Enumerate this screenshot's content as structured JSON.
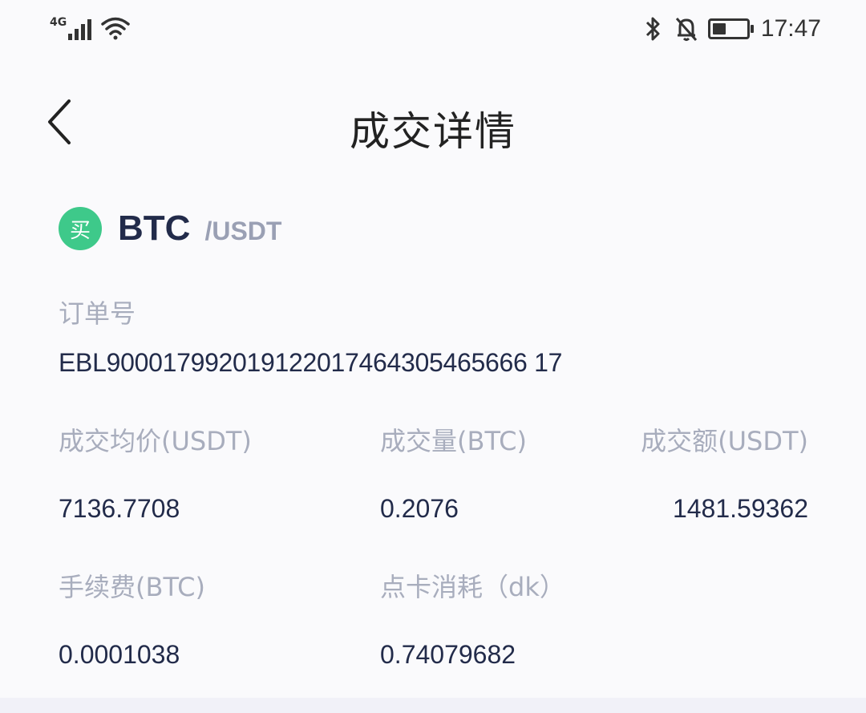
{
  "status_bar": {
    "network": "4G",
    "time": "17:47",
    "battery_level": 0.4
  },
  "nav": {
    "title": "成交详情",
    "back_icon": "chevron-left-icon"
  },
  "pair": {
    "side_badge": "买",
    "base": "BTC",
    "quote": "/USDT",
    "badge_color": "#3ec98a"
  },
  "order": {
    "label": "订单号",
    "value": "EBL900017992019122017464305465666 17"
  },
  "stats_row1": {
    "avg_price_label": "成交均价(USDT)",
    "avg_price_value": "7136.7708",
    "volume_label": "成交量(BTC)",
    "volume_value": "0.2076",
    "amount_label": "成交额(USDT)",
    "amount_value": "1481.59362"
  },
  "stats_row2": {
    "fee_label": "手续费(BTC)",
    "fee_value": "0.0001038",
    "card_label": "点卡消耗（dk）",
    "card_value": "0.74079682"
  }
}
